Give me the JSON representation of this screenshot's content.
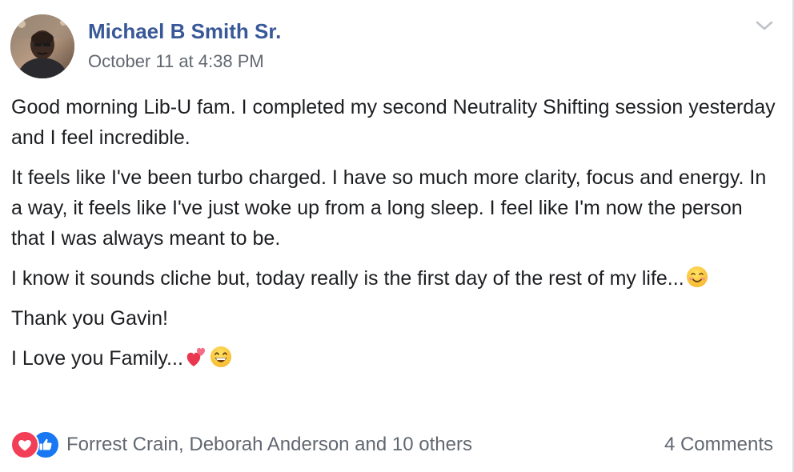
{
  "post": {
    "author": "Michael B Smith Sr.",
    "timestamp": "October 11 at 4:38 PM",
    "menu_icon": "chevron-down-icon",
    "paragraphs": {
      "p1": "Good morning Lib-U fam. I completed my second Neutrality Shifting session yesterday and I feel incredible.",
      "p2": "It feels like I've been turbo charged. I have so much more clarity, focus and energy. In a way, it feels like I've just woke up from a long sleep. I feel like I'm now the person that I was always meant to be.",
      "p3": "I know it sounds cliche but, today really is the first day of the rest of my life...",
      "p4": "Thank you Gavin!",
      "p5": "I Love you Family..."
    },
    "emojis": {
      "p3": [
        "smiling-face-emoji"
      ],
      "p5": [
        "two-hearts-emoji",
        "grinning-face-emoji"
      ]
    }
  },
  "footer": {
    "reactions": [
      "love-reaction-icon",
      "like-reaction-icon"
    ],
    "reaction_names": "Forrest Crain, Deborah Anderson and 10 others",
    "comments": "4 Comments"
  },
  "colors": {
    "author_link": "#385898",
    "secondary_text": "#616770",
    "body_text": "#1c1e21",
    "love": "#f33e58",
    "like": "#1877f2"
  }
}
